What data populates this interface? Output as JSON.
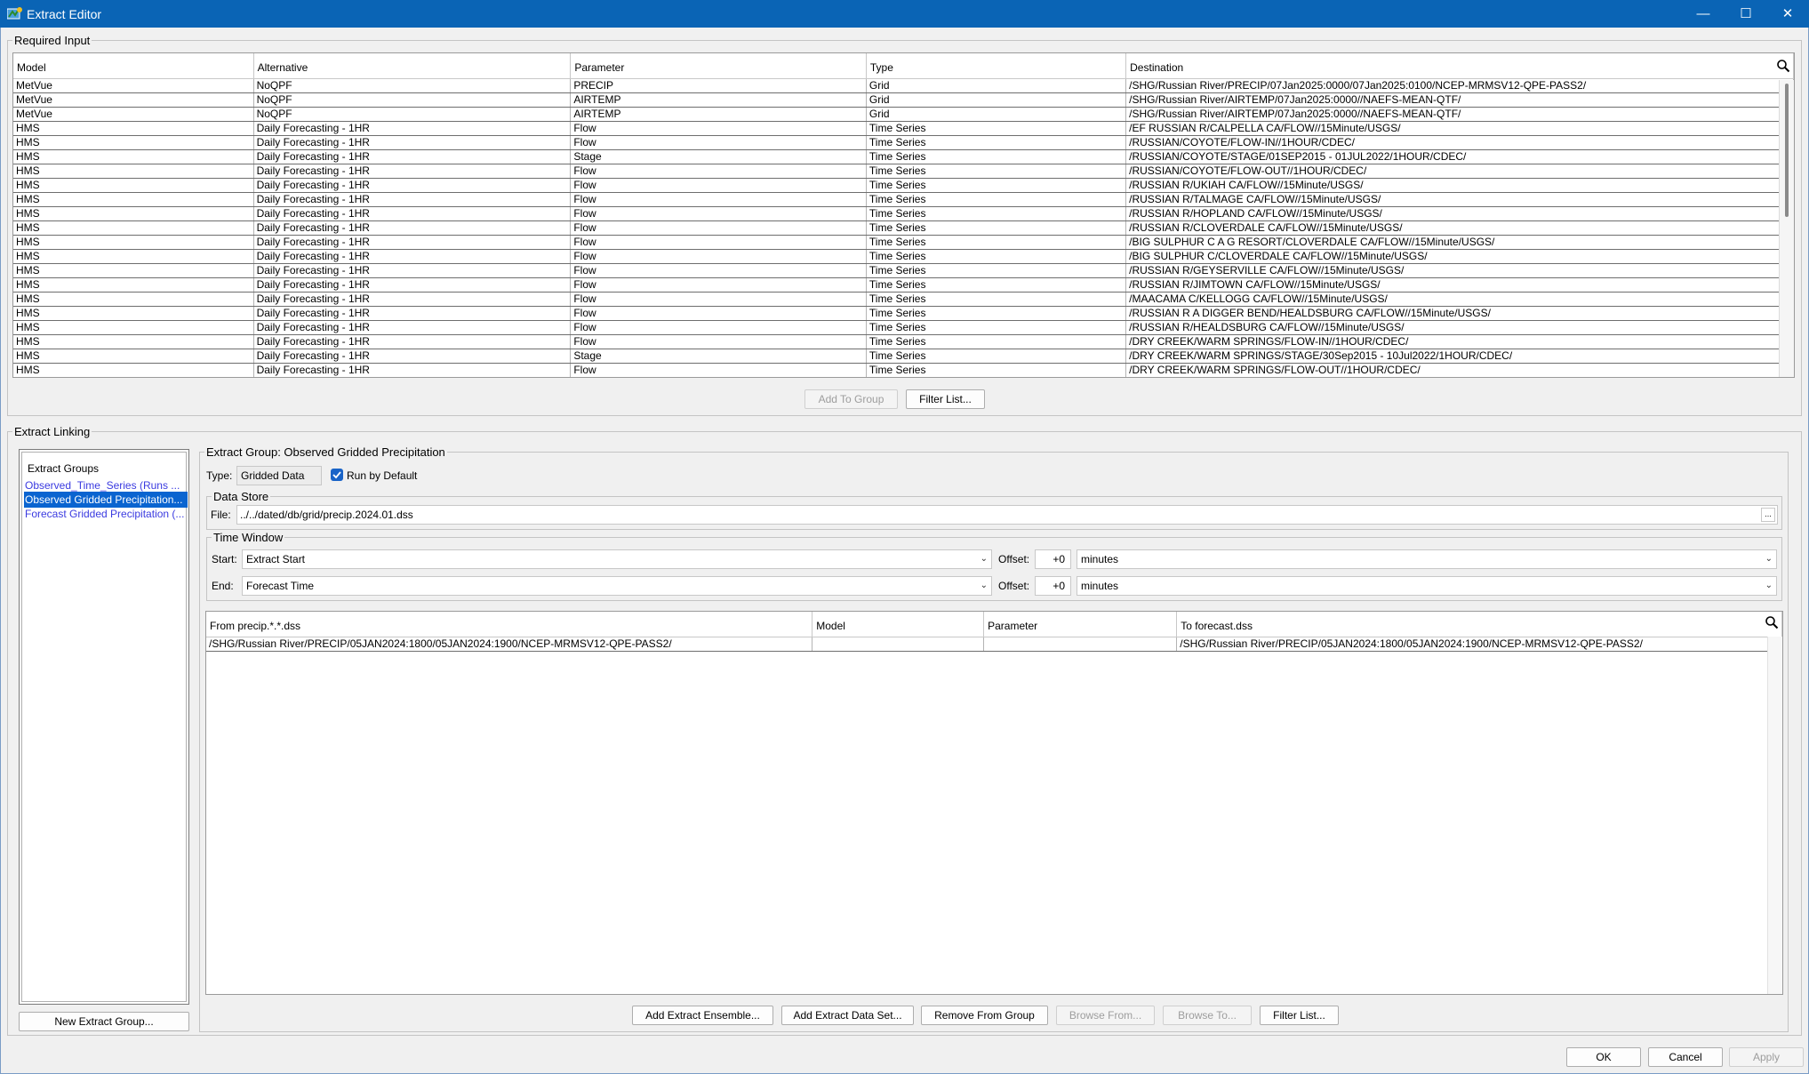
{
  "window": {
    "title": "Extract Editor",
    "minimize": "—",
    "maximize": "☐",
    "close": "✕"
  },
  "required_input": {
    "legend": "Required Input",
    "columns": [
      "Model",
      "Alternative",
      "Parameter",
      "Type",
      "Destination"
    ],
    "rows": [
      [
        "MetVue",
        "NoQPF",
        "PRECIP",
        "Grid",
        "/SHG/Russian River/PRECIP/07Jan2025:0000/07Jan2025:0100/NCEP-MRMSV12-QPE-PASS2/"
      ],
      [
        "MetVue",
        "NoQPF",
        "AIRTEMP",
        "Grid",
        "/SHG/Russian River/AIRTEMP/07Jan2025:0000//NAEFS-MEAN-QTF/"
      ],
      [
        "MetVue",
        "NoQPF",
        "AIRTEMP",
        "Grid",
        "/SHG/Russian River/AIRTEMP/07Jan2025:0000//NAEFS-MEAN-QTF/"
      ],
      [
        "HMS",
        "Daily Forecasting - 1HR",
        "Flow",
        "Time Series",
        "/EF RUSSIAN R/CALPELLA CA/FLOW//15Minute/USGS/"
      ],
      [
        "HMS",
        "Daily Forecasting - 1HR",
        "Flow",
        "Time Series",
        "/RUSSIAN/COYOTE/FLOW-IN//1HOUR/CDEC/"
      ],
      [
        "HMS",
        "Daily Forecasting - 1HR",
        "Stage",
        "Time Series",
        "/RUSSIAN/COYOTE/STAGE/01SEP2015 - 01JUL2022/1HOUR/CDEC/"
      ],
      [
        "HMS",
        "Daily Forecasting - 1HR",
        "Flow",
        "Time Series",
        "/RUSSIAN/COYOTE/FLOW-OUT//1HOUR/CDEC/"
      ],
      [
        "HMS",
        "Daily Forecasting - 1HR",
        "Flow",
        "Time Series",
        "/RUSSIAN R/UKIAH CA/FLOW//15Minute/USGS/"
      ],
      [
        "HMS",
        "Daily Forecasting - 1HR",
        "Flow",
        "Time Series",
        "/RUSSIAN R/TALMAGE CA/FLOW//15Minute/USGS/"
      ],
      [
        "HMS",
        "Daily Forecasting - 1HR",
        "Flow",
        "Time Series",
        "/RUSSIAN R/HOPLAND CA/FLOW//15Minute/USGS/"
      ],
      [
        "HMS",
        "Daily Forecasting - 1HR",
        "Flow",
        "Time Series",
        "/RUSSIAN R/CLOVERDALE CA/FLOW//15Minute/USGS/"
      ],
      [
        "HMS",
        "Daily Forecasting - 1HR",
        "Flow",
        "Time Series",
        "/BIG SULPHUR C A G RESORT/CLOVERDALE CA/FLOW//15Minute/USGS/"
      ],
      [
        "HMS",
        "Daily Forecasting - 1HR",
        "Flow",
        "Time Series",
        "/BIG SULPHUR C/CLOVERDALE CA/FLOW//15Minute/USGS/"
      ],
      [
        "HMS",
        "Daily Forecasting - 1HR",
        "Flow",
        "Time Series",
        "/RUSSIAN R/GEYSERVILLE CA/FLOW//15Minute/USGS/"
      ],
      [
        "HMS",
        "Daily Forecasting - 1HR",
        "Flow",
        "Time Series",
        "/RUSSIAN R/JIMTOWN CA/FLOW//15Minute/USGS/"
      ],
      [
        "HMS",
        "Daily Forecasting - 1HR",
        "Flow",
        "Time Series",
        "/MAACAMA C/KELLOGG CA/FLOW//15Minute/USGS/"
      ],
      [
        "HMS",
        "Daily Forecasting - 1HR",
        "Flow",
        "Time Series",
        "/RUSSIAN R A DIGGER BEND/HEALDSBURG CA/FLOW//15Minute/USGS/"
      ],
      [
        "HMS",
        "Daily Forecasting - 1HR",
        "Flow",
        "Time Series",
        "/RUSSIAN R/HEALDSBURG CA/FLOW//15Minute/USGS/"
      ],
      [
        "HMS",
        "Daily Forecasting - 1HR",
        "Flow",
        "Time Series",
        "/DRY CREEK/WARM SPRINGS/FLOW-IN//1HOUR/CDEC/"
      ],
      [
        "HMS",
        "Daily Forecasting - 1HR",
        "Stage",
        "Time Series",
        "/DRY CREEK/WARM SPRINGS/STAGE/30Sep2015 - 10Jul2022/1HOUR/CDEC/"
      ],
      [
        "HMS",
        "Daily Forecasting - 1HR",
        "Flow",
        "Time Series",
        "/DRY CREEK/WARM SPRINGS/FLOW-OUT//1HOUR/CDEC/"
      ]
    ],
    "add_to_group": "Add To Group",
    "filter_list": "Filter List..."
  },
  "extract_linking": {
    "legend": "Extract Linking",
    "groups_header": "Extract Groups",
    "groups": [
      {
        "label": "Observed_Time_Series (Runs ...",
        "selected": false
      },
      {
        "label": "Observed Gridded Precipitation...",
        "selected": true
      },
      {
        "label": "Forecast Gridded Precipitation (...",
        "selected": false
      }
    ],
    "new_group": "New Extract Group...",
    "group_detail": {
      "legend": "Extract Group: Observed Gridded Precipitation",
      "type_label": "Type:",
      "type_value": "Gridded Data",
      "run_by_default": "Run by Default",
      "run_by_default_checked": true,
      "data_store_legend": "Data Store",
      "file_label": "File:",
      "file_value": "../../dated/db/grid/precip.2024.01.dss",
      "browse_label": "...",
      "time_window_legend": "Time Window",
      "start_label": "Start:",
      "start_value": "Extract Start",
      "end_label": "End:",
      "end_value": "Forecast Time",
      "offset_label": "Offset:",
      "start_offset": "+0",
      "end_offset": "+0",
      "start_unit": "minutes",
      "end_unit": "minutes",
      "mapping_columns": [
        "From precip.*.*.dss",
        "Model",
        "Parameter",
        "To forecast.dss"
      ],
      "mapping_rows": [
        [
          "/SHG/Russian River/PRECIP/05JAN2024:1800/05JAN2024:1900/NCEP-MRMSV12-QPE-PASS2/",
          "",
          "",
          "/SHG/Russian River/PRECIP/05JAN2024:1800/05JAN2024:1900/NCEP-MRMSV12-QPE-PASS2/"
        ]
      ],
      "buttons": {
        "add_ensemble": "Add Extract Ensemble...",
        "add_data_set": "Add Extract Data Set...",
        "remove_from_group": "Remove From Group",
        "browse_from": "Browse From...",
        "browse_to": "Browse To...",
        "filter_list": "Filter List..."
      }
    }
  },
  "footer": {
    "ok": "OK",
    "cancel": "Cancel",
    "apply": "Apply"
  },
  "colors": {
    "titlebar": "#0a64b5",
    "selection": "#0a64d0",
    "link_text": "#3a3ae0"
  }
}
